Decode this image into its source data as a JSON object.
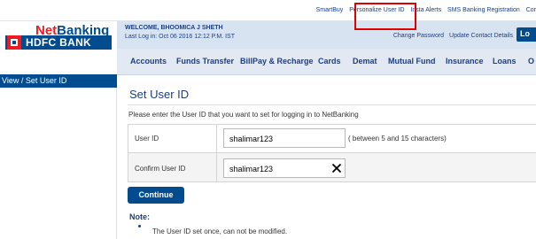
{
  "top_links": [
    "SmartBuy",
    "Personalize User ID",
    "Insta Alerts",
    "SMS Banking Registration",
    "Cor"
  ],
  "brand": {
    "netbanking_prefix": "Net",
    "netbanking_suffix": "Banking",
    "bank_name": "HDFC BANK"
  },
  "user": {
    "welcome": "WELCOME, BHOOMICA J SHETH",
    "last_login": "Last Log in: Oct 06 2016 12:12 P.M. IST"
  },
  "header_links": [
    "Change Password",
    "Update Contact Details"
  ],
  "logout_label": "Lo",
  "nav_items": [
    "Accounts",
    "Funds Transfer",
    "BillPay & Recharge",
    "Cards",
    "Demat",
    "Mutual Fund",
    "Insurance",
    "Loans",
    "O"
  ],
  "sidebar": {
    "active_item": "View / Set User ID"
  },
  "main": {
    "title": "Set User ID",
    "instruction": "Please enter the User ID that you want to set for logging in to NetBanking",
    "user_id_label": "User ID",
    "user_id_value": "shalimar123",
    "user_id_hint": "( between 5 and 15 characters)",
    "confirm_label": "Confirm User ID",
    "confirm_value": "shalimar123",
    "continue_label": "Continue",
    "note_heading": "Note:",
    "notes": [
      "The User ID set once, can not be modified."
    ]
  },
  "colors": {
    "brand_blue": "#004c8f",
    "brand_red": "#ed1c24",
    "highlight": "#e00000"
  },
  "icons": {
    "clear": "close-icon",
    "logo": "hdfc-logo-icon"
  }
}
